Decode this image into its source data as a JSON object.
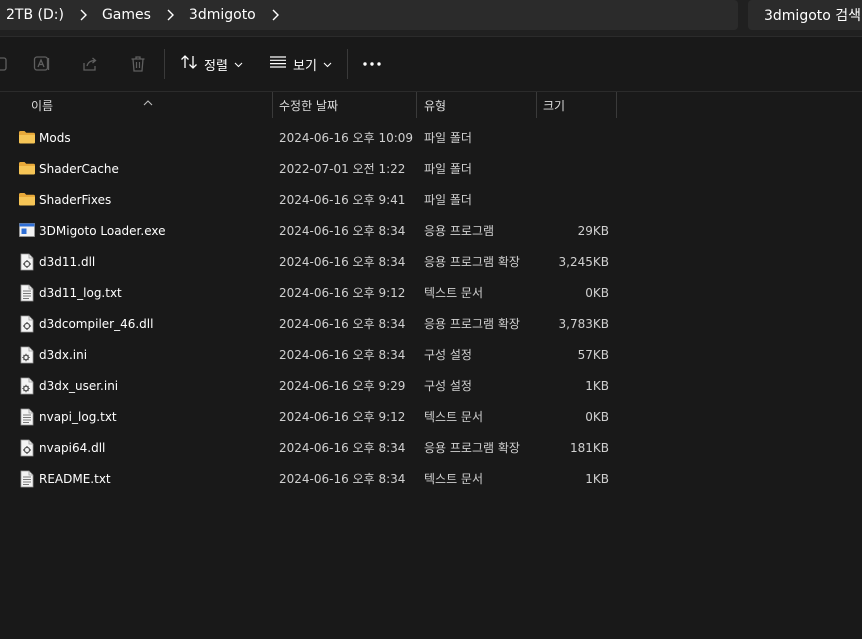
{
  "breadcrumb": {
    "items": [
      "2TB (D:)",
      "Games",
      "3dmigoto"
    ]
  },
  "search": {
    "text": "3dmigoto 검색"
  },
  "toolbar": {
    "sort_label": "정렬",
    "view_label": "보기"
  },
  "columns": {
    "name": "이름",
    "modified": "수정한 날짜",
    "type": "유형",
    "size": "크기"
  },
  "files": [
    {
      "name": "Mods",
      "modified": "2024-06-16 오후 10:09",
      "type": "파일 폴더",
      "size": "",
      "icon": "folder-icon"
    },
    {
      "name": "ShaderCache",
      "modified": "2022-07-01 오전 1:22",
      "type": "파일 폴더",
      "size": "",
      "icon": "folder-icon"
    },
    {
      "name": "ShaderFixes",
      "modified": "2024-06-16 오후 9:41",
      "type": "파일 폴더",
      "size": "",
      "icon": "folder-icon"
    },
    {
      "name": "3DMigoto Loader.exe",
      "modified": "2024-06-16 오후 8:34",
      "type": "응용 프로그램",
      "size": "29KB",
      "icon": "exe-icon"
    },
    {
      "name": "d3d11.dll",
      "modified": "2024-06-16 오후 8:34",
      "type": "응용 프로그램 확장",
      "size": "3,245KB",
      "icon": "dll-icon"
    },
    {
      "name": "d3d11_log.txt",
      "modified": "2024-06-16 오후 9:12",
      "type": "텍스트 문서",
      "size": "0KB",
      "icon": "text-file-icon"
    },
    {
      "name": "d3dcompiler_46.dll",
      "modified": "2024-06-16 오후 8:34",
      "type": "응용 프로그램 확장",
      "size": "3,783KB",
      "icon": "dll-icon"
    },
    {
      "name": "d3dx.ini",
      "modified": "2024-06-16 오후 8:34",
      "type": "구성 설정",
      "size": "57KB",
      "icon": "ini-icon"
    },
    {
      "name": "d3dx_user.ini",
      "modified": "2024-06-16 오후 9:29",
      "type": "구성 설정",
      "size": "1KB",
      "icon": "ini-icon"
    },
    {
      "name": "nvapi_log.txt",
      "modified": "2024-06-16 오후 9:12",
      "type": "텍스트 문서",
      "size": "0KB",
      "icon": "text-file-icon"
    },
    {
      "name": "nvapi64.dll",
      "modified": "2024-06-16 오후 8:34",
      "type": "응용 프로그램 확장",
      "size": "181KB",
      "icon": "dll-icon"
    },
    {
      "name": "README.txt",
      "modified": "2024-06-16 오후 8:34",
      "type": "텍스트 문서",
      "size": "1KB",
      "icon": "text-file-icon"
    }
  ],
  "colors": {
    "background": "#191919",
    "bar": "#2b2b2b",
    "folder": "#f3c04d",
    "text": "#ffffff"
  }
}
